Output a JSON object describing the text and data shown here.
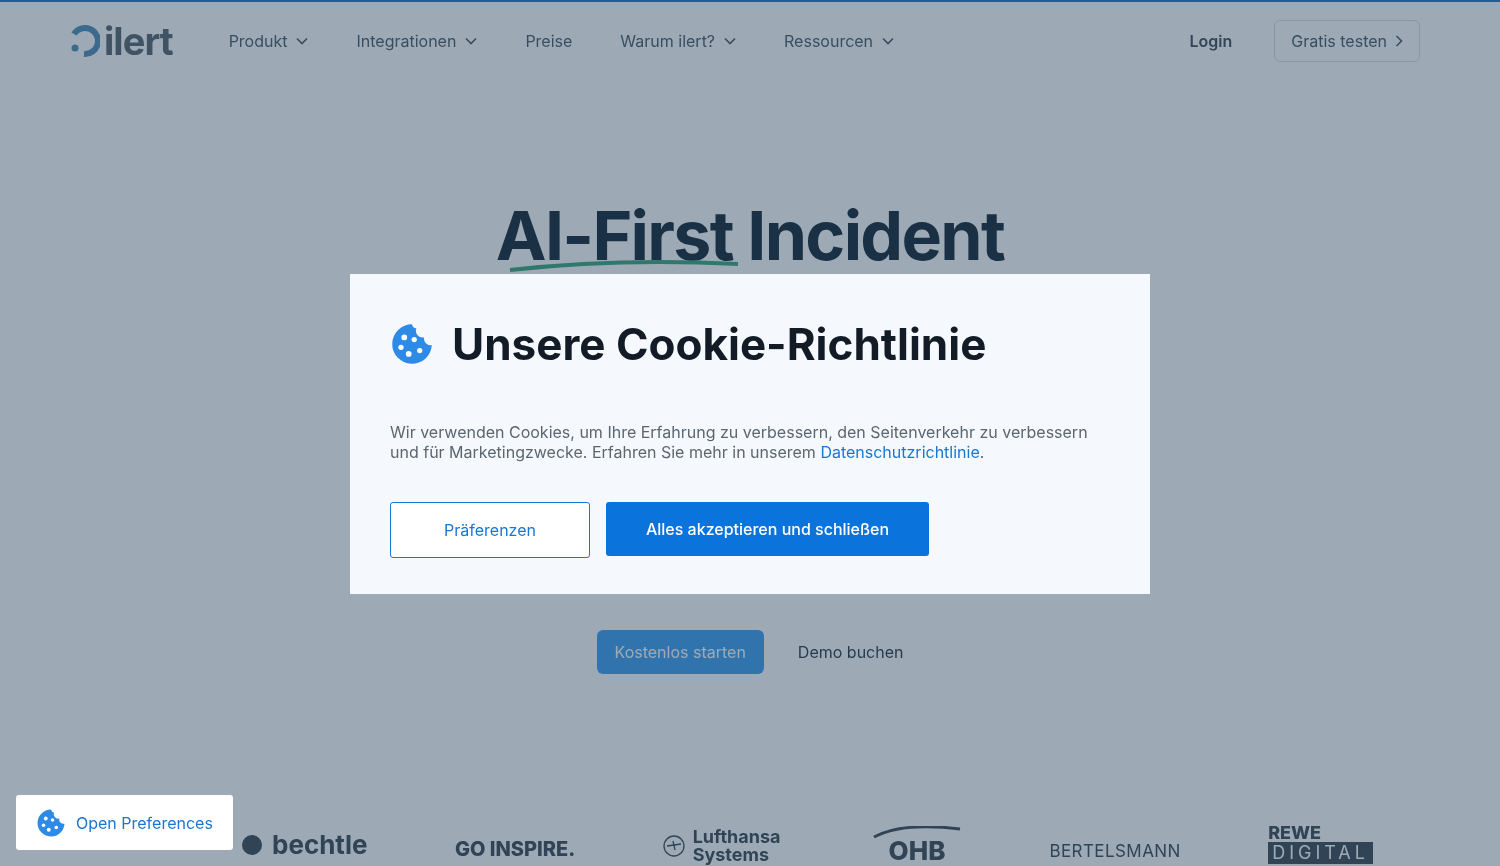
{
  "nav": {
    "logo": "ilert",
    "items": [
      {
        "label": "Produkt",
        "has_menu": true
      },
      {
        "label": "Integrationen",
        "has_menu": true
      },
      {
        "label": "Preise",
        "has_menu": false
      },
      {
        "label": "Warum ilert?",
        "has_menu": true
      },
      {
        "label": "Ressourcen",
        "has_menu": true
      }
    ],
    "login": "Login",
    "cta": "Gratis testen"
  },
  "hero": {
    "headline": "AI-First Incident",
    "primary_button": "Kostenlos starten",
    "secondary_button": "Demo buchen"
  },
  "logos": [
    {
      "kind": "circle",
      "text": "bechtle"
    },
    {
      "kind": "bold",
      "text": "GO INSPIRE."
    },
    {
      "kind": "plane",
      "text": "Lufthansa Systems"
    },
    {
      "kind": "swoosh",
      "text": "OHB"
    },
    {
      "kind": "thin",
      "text": "BERTELSMANN"
    },
    {
      "kind": "stack",
      "text": "REWE",
      "text2": "DIGITAL"
    }
  ],
  "cookie_dialog": {
    "title": "Unsere Cookie-Richtlinie",
    "body": "Wir verwenden Cookies, um Ihre Erfahrung zu verbessern, den Seitenverkehr zu verbessern und für Marketingzwecke. Erfahren Sie mehr in unserem ",
    "link": "Datenschutzrichtlinie",
    "after_link": ".",
    "preferences_button": "Präferenzen",
    "accept_button": "Alles akzeptieren und schließen"
  },
  "floating_button": "Open Preferences"
}
